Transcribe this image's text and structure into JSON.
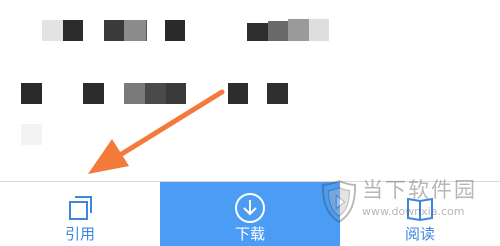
{
  "toolbar": {
    "cite_label": "引用",
    "download_label": "下载",
    "read_label": "阅读"
  },
  "watermark": {
    "title": "当下软件园",
    "url": "www.downxia.com"
  },
  "colors": {
    "accent_blue": "#4a9cf4",
    "arrow_orange": "#f47a3c",
    "icon_blue": "#3d86e0"
  },
  "icons": {
    "cite": "copy-squares-icon",
    "download": "circle-download-icon",
    "read": "open-book-icon",
    "watermark_logo": "shield-logo-icon"
  }
}
